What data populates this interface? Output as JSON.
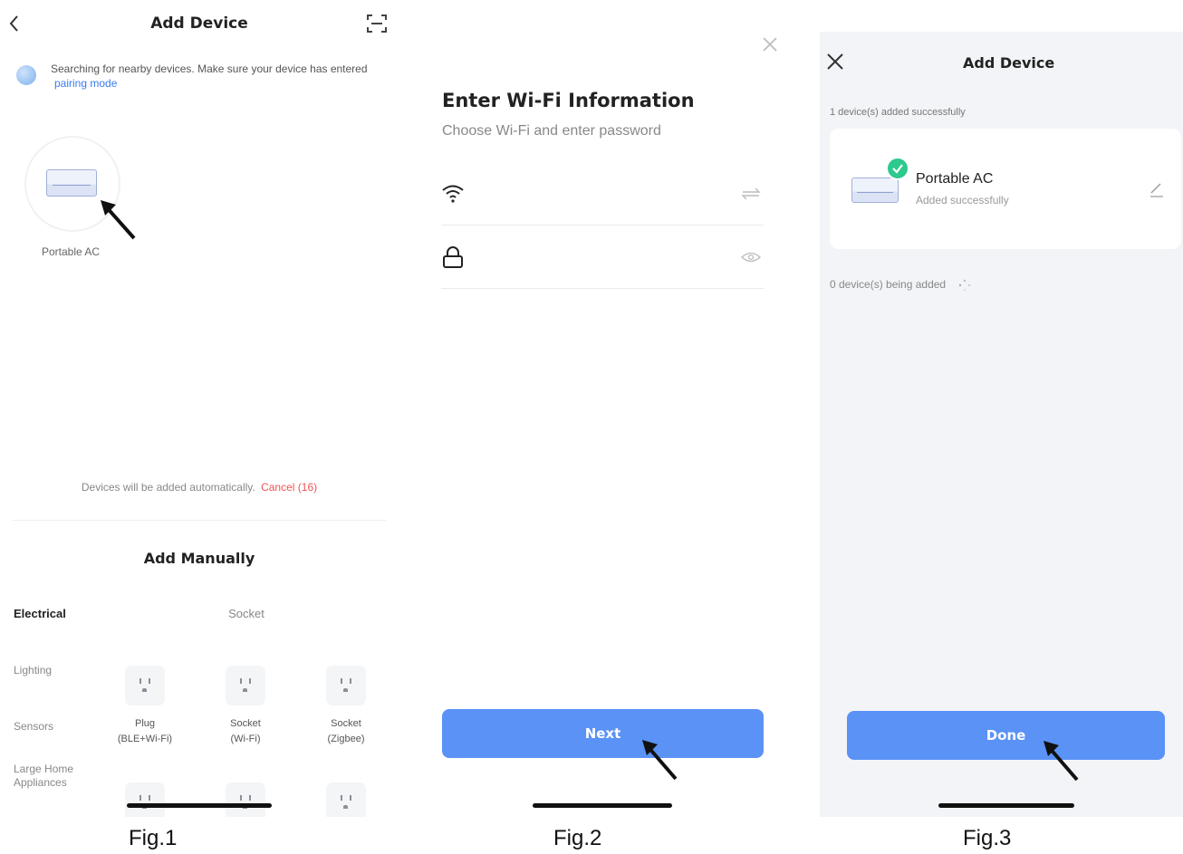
{
  "fig1": {
    "header": {
      "title": "Add Device"
    },
    "search": {
      "text": "Searching for nearby devices. Make sure your device has entered",
      "link": "pairing mode"
    },
    "found_device": {
      "name": "Portable AC"
    },
    "auto_notice": {
      "text": "Devices will be added automatically.",
      "cancel": "Cancel (16)"
    },
    "manual": {
      "title": "Add Manually",
      "categories": [
        "Electrical",
        "Lighting",
        "Sensors",
        "Large Home Appliances"
      ],
      "active_category": "Electrical",
      "section": "Socket",
      "items": [
        {
          "line1": "Plug",
          "line2": "(BLE+Wi-Fi)"
        },
        {
          "line1": "Socket",
          "line2": "(Wi-Fi)"
        },
        {
          "line1": "Socket",
          "line2": "(Zigbee)"
        }
      ]
    },
    "caption": "Fig.1"
  },
  "fig2": {
    "title": "Enter Wi-Fi Information",
    "subtitle": "Choose Wi-Fi and enter password",
    "wifi_value": "",
    "password_value": "",
    "next_label": "Next",
    "caption": "Fig.2"
  },
  "fig3": {
    "header": {
      "title": "Add Device"
    },
    "added_text": "1 device(s) added successfully",
    "device": {
      "name": "Portable AC",
      "status": "Added successfully"
    },
    "adding_text": "0 device(s) being added",
    "done_label": "Done",
    "caption": "Fig.3"
  },
  "colors": {
    "accent": "#5a92f6",
    "link": "#3a7bf0",
    "cancel": "#f05454",
    "success": "#2ec98e"
  }
}
